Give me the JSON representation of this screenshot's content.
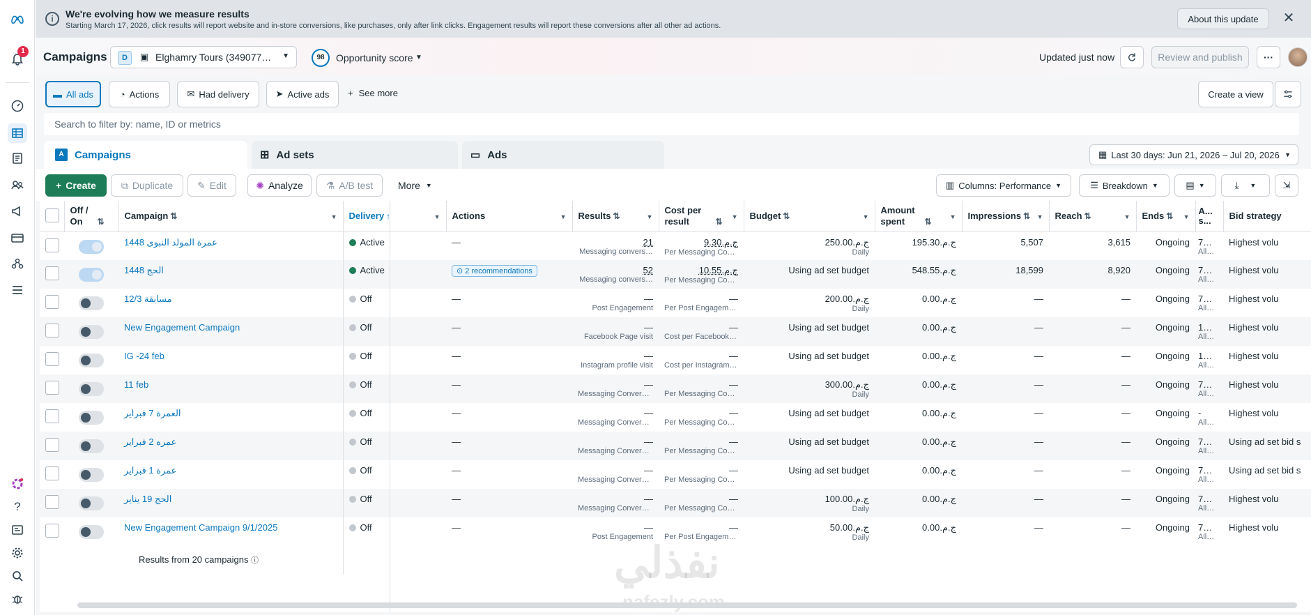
{
  "banner": {
    "title": "We're evolving how we measure results",
    "subtitle": "Starting March 17, 2026, click results will report website and in-store conversions, like purchases, only after link clicks. Engagement results will report these conversions after all other ad actions.",
    "about_label": "About this update"
  },
  "rail": {
    "notification_count": "1"
  },
  "header": {
    "title": "Campaigns",
    "account_initial": "D",
    "account_name": "Elghamry Tours (349077…",
    "opportunity_score": "98",
    "opportunity_label": "Opportunity score",
    "updated_text": "Updated just now",
    "review_publish_label": "Review and publish",
    "more_label": "···"
  },
  "views": {
    "tabs": [
      "All ads",
      "Actions",
      "Had delivery",
      "Active ads"
    ],
    "see_more": "See more",
    "create_view": "Create a view"
  },
  "search": {
    "placeholder": "Search to filter by: name, ID or metrics"
  },
  "levels": {
    "campaigns": "Campaigns",
    "ad_sets": "Ad sets",
    "ads": "Ads"
  },
  "date_range": "Last 30 days: Jun 21, 2026 – Jul 20, 2026",
  "actions": {
    "create": "Create",
    "duplicate": "Duplicate",
    "edit": "Edit",
    "analyze": "Analyze",
    "ab_test": "A/B test",
    "more": "More",
    "columns": "Columns: Performance",
    "breakdown": "Breakdown"
  },
  "columns": {
    "off_on": "Off / On",
    "campaign": "Campaign",
    "delivery": "Delivery",
    "actions": "Actions",
    "results": "Results",
    "cost_per_result": "Cost per result",
    "budget": "Budget",
    "amount_spent": "Amount spent",
    "impressions": "Impressions",
    "reach": "Reach",
    "ends": "Ends",
    "attribution": "A... s...",
    "bid_strategy": "Bid strategy"
  },
  "rows": [
    {
      "on": true,
      "name": "عمرة المولد النبوى 1448",
      "delivery": "Active",
      "delivery_color": "#1d7d58",
      "actions": "—",
      "results": "21",
      "results_sub": "Messaging convers…",
      "cpr": "ج.م.9.30",
      "cpr_sub": "Per Messaging Con…",
      "budget": "ج.م.250.00",
      "budget_sub": "Daily",
      "spent": "ج.م.195.30",
      "impressions": "5,507",
      "reach": "3,615",
      "ends": "Ongoing",
      "attr": "7…",
      "attr_sub": "All…",
      "bid": "Highest volu"
    },
    {
      "on": true,
      "name": "الحج 1448",
      "delivery": "Active",
      "delivery_color": "#1d7d58",
      "actions": "2 recommendations",
      "results": "52",
      "results_sub": "Messaging convers…",
      "cpr": "ج.م.10.55",
      "cpr_sub": "Per Messaging Con…",
      "budget": "Using ad set budget",
      "budget_sub": "",
      "spent": "ج.م.548.55",
      "impressions": "18,599",
      "reach": "8,920",
      "ends": "Ongoing",
      "attr": "7…",
      "attr_sub": "All…",
      "bid": "Highest volu"
    },
    {
      "on": false,
      "name": "مسابقة 12/3",
      "delivery": "Off",
      "delivery_color": "#c1c7cc",
      "actions": "—",
      "results": "—",
      "results_sub": "Post Engagement",
      "cpr": "—",
      "cpr_sub": "Per Post Engagement",
      "budget": "ج.م.200.00",
      "budget_sub": "Daily",
      "spent": "ج.م.0.00",
      "impressions": "—",
      "reach": "—",
      "ends": "Ongoing",
      "attr": "7…",
      "attr_sub": "All…",
      "bid": "Highest volu"
    },
    {
      "on": false,
      "name": "New Engagement Campaign",
      "delivery": "Off",
      "delivery_color": "#c1c7cc",
      "actions": "—",
      "results": "—",
      "results_sub": "Facebook Page visit",
      "cpr": "—",
      "cpr_sub": "Cost per Facebook P…",
      "budget": "Using ad set budget",
      "budget_sub": "",
      "spent": "ج.م.0.00",
      "impressions": "—",
      "reach": "—",
      "ends": "Ongoing",
      "attr": "1…",
      "attr_sub": "All…",
      "bid": "Highest volu"
    },
    {
      "on": false,
      "name": "IG -24 feb",
      "delivery": "Off",
      "delivery_color": "#c1c7cc",
      "actions": "—",
      "results": "—",
      "results_sub": "Instagram profile visit",
      "cpr": "—",
      "cpr_sub": "Cost per Instagram …",
      "budget": "Using ad set budget",
      "budget_sub": "",
      "spent": "ج.م.0.00",
      "impressions": "—",
      "reach": "—",
      "ends": "Ongoing",
      "attr": "1…",
      "attr_sub": "All…",
      "bid": "Highest volu"
    },
    {
      "on": false,
      "name": "11 feb",
      "delivery": "Off",
      "delivery_color": "#c1c7cc",
      "actions": "—",
      "results": "—",
      "results_sub": "Messaging Conversa…",
      "cpr": "—",
      "cpr_sub": "Per Messaging Conv…",
      "budget": "ج.م.300.00",
      "budget_sub": "Daily",
      "spent": "ج.م.0.00",
      "impressions": "—",
      "reach": "—",
      "ends": "Ongoing",
      "attr": "7…",
      "attr_sub": "All…",
      "bid": "Highest volu"
    },
    {
      "on": false,
      "name": "العمرة 7 فبراير",
      "delivery": "Off",
      "delivery_color": "#c1c7cc",
      "actions": "—",
      "results": "—",
      "results_sub": "Messaging Conversa…",
      "cpr": "—",
      "cpr_sub": "Per Messaging Conv…",
      "budget": "Using ad set budget",
      "budget_sub": "",
      "spent": "ج.م.0.00",
      "impressions": "—",
      "reach": "—",
      "ends": "Ongoing",
      "attr": "-",
      "attr_sub": "All…",
      "bid": "Highest volu"
    },
    {
      "on": false,
      "name": "عمره 2 فبراير",
      "delivery": "Off",
      "delivery_color": "#c1c7cc",
      "actions": "—",
      "results": "—",
      "results_sub": "Messaging Conversa…",
      "cpr": "—",
      "cpr_sub": "Per Messaging Conv…",
      "budget": "Using ad set budget",
      "budget_sub": "",
      "spent": "ج.م.0.00",
      "impressions": "—",
      "reach": "—",
      "ends": "Ongoing",
      "attr": "7…",
      "attr_sub": "All…",
      "bid": "Using ad set bid s"
    },
    {
      "on": false,
      "name": "عمرة 1 فبراير",
      "delivery": "Off",
      "delivery_color": "#c1c7cc",
      "actions": "—",
      "results": "—",
      "results_sub": "Messaging Conversa…",
      "cpr": "—",
      "cpr_sub": "Per Messaging Conv…",
      "budget": "Using ad set budget",
      "budget_sub": "",
      "spent": "ج.م.0.00",
      "impressions": "—",
      "reach": "—",
      "ends": "Ongoing",
      "attr": "7…",
      "attr_sub": "All…",
      "bid": "Using ad set bid s"
    },
    {
      "on": false,
      "name": "الحج 19 يناير",
      "delivery": "Off",
      "delivery_color": "#c1c7cc",
      "actions": "—",
      "results": "—",
      "results_sub": "Messaging Conversa…",
      "cpr": "—",
      "cpr_sub": "Per Messaging Conv…",
      "budget": "ج.م.100.00",
      "budget_sub": "Daily",
      "spent": "ج.م.0.00",
      "impressions": "—",
      "reach": "—",
      "ends": "Ongoing",
      "attr": "7…",
      "attr_sub": "All…",
      "bid": "Highest volu"
    },
    {
      "on": false,
      "name": "New Engagement Campaign 9/1/2025",
      "delivery": "Off",
      "delivery_color": "#c1c7cc",
      "actions": "—",
      "results": "—",
      "results_sub": "Post Engagement",
      "cpr": "—",
      "cpr_sub": "Per Post Engagement",
      "budget": "ج.م.50.00",
      "budget_sub": "Daily",
      "spent": "ج.م.0.00",
      "impressions": "—",
      "reach": "—",
      "ends": "Ongoing",
      "attr": "7…",
      "attr_sub": "All…",
      "bid": "Highest volu"
    }
  ],
  "footer": {
    "results_from": "Results from 20 campaigns"
  },
  "watermark": {
    "arabic": "نفذلي",
    "latin": "nafezly.com"
  }
}
